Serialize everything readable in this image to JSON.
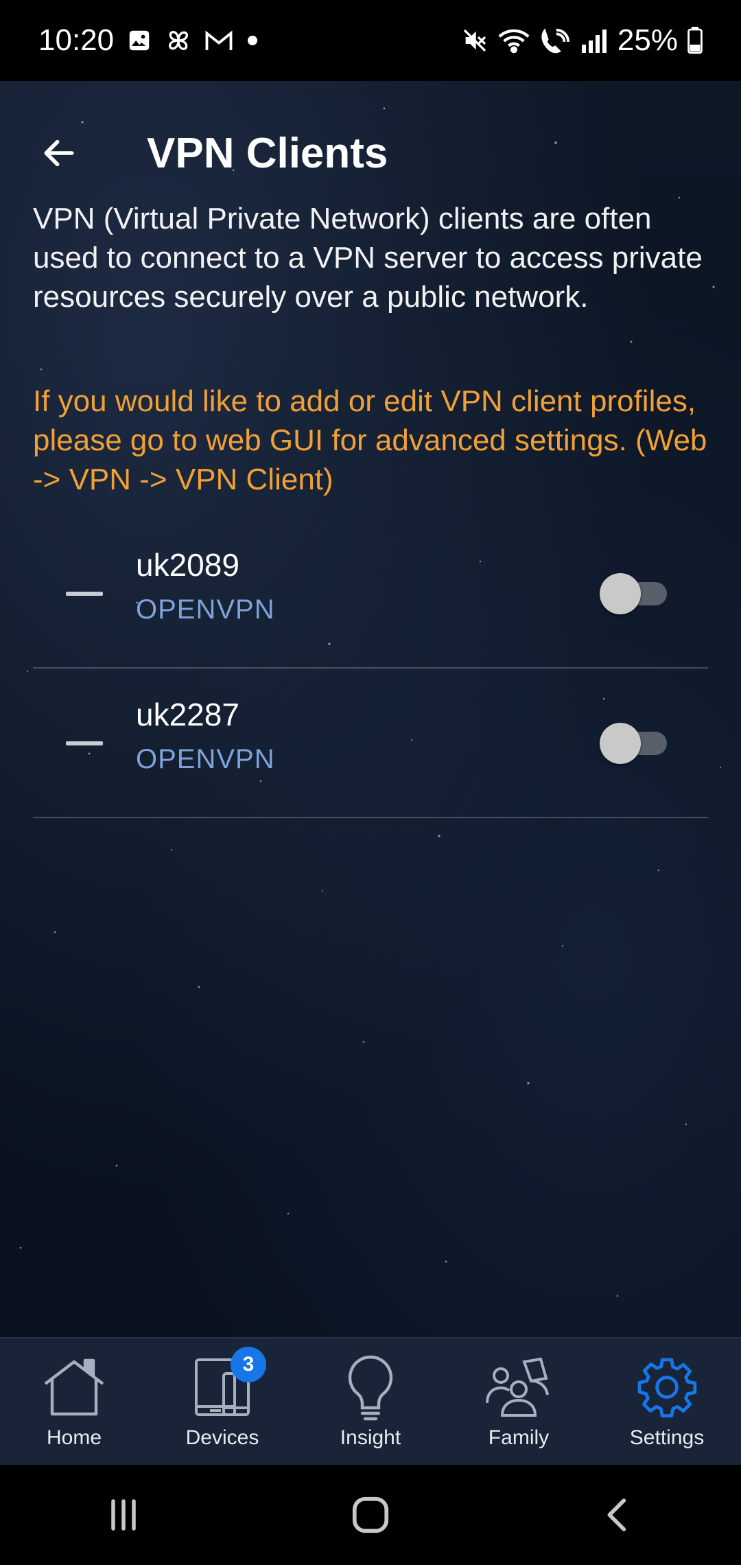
{
  "status_bar": {
    "time": "10:20",
    "battery": "25%",
    "icons_left": [
      "image-icon",
      "pinwheel-icon",
      "gmail-icon",
      "dot-icon"
    ],
    "icons_right": [
      "mute-icon",
      "wifi-icon",
      "wifi-calling-icon",
      "signal-icon",
      "battery-icon"
    ]
  },
  "header": {
    "title": "VPN Clients"
  },
  "description": "VPN (Virtual Private Network) clients are often used to connect to a VPN server to access private resources securely over a public network.",
  "notice": "If you would like to add or edit VPN client profiles, please go to web GUI for advanced settings. (Web -> VPN -> VPN Client)",
  "vpn_clients": [
    {
      "name": "uk2089",
      "type": "OPENVPN",
      "enabled": false
    },
    {
      "name": "uk2287",
      "type": "OPENVPN",
      "enabled": false
    }
  ],
  "bottom_nav": {
    "items": [
      {
        "label": "Home",
        "icon": "home-icon",
        "active": false
      },
      {
        "label": "Devices",
        "icon": "devices-icon",
        "active": false,
        "badge": "3"
      },
      {
        "label": "Insight",
        "icon": "lightbulb-icon",
        "active": false
      },
      {
        "label": "Family",
        "icon": "family-icon",
        "active": false
      },
      {
        "label": "Settings",
        "icon": "gear-icon",
        "active": true
      }
    ]
  },
  "colors": {
    "accent": "#1677e8",
    "notice": "#f0a035",
    "vpn_type": "#7fa2d8",
    "nav_bg": "#1a2438"
  }
}
